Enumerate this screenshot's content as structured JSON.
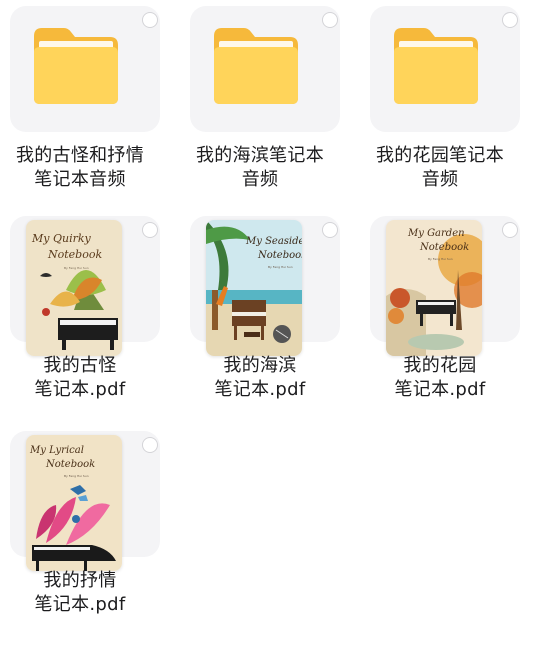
{
  "items": [
    {
      "type": "folder",
      "name": "我的古怪和抒情笔记本音频",
      "line1": "我的古怪和抒情",
      "line2": "笔记本音频"
    },
    {
      "type": "folder",
      "name": "我的海滨笔记本音频",
      "line1": "我的海滨笔记本",
      "line2": "音频"
    },
    {
      "type": "folder",
      "name": "我的花园笔记本音频",
      "line1": "我的花园笔记本",
      "line2": "音频"
    },
    {
      "type": "pdf",
      "name": "我的古怪笔记本.pdf",
      "line1": "我的古怪",
      "line2": "笔记本.pdf",
      "cover_title_1": "My Quirky",
      "cover_title_2": "Notebook",
      "cover_author": "By Feng Hui Sun"
    },
    {
      "type": "pdf",
      "name": "我的海滨笔记本.pdf",
      "line1": "我的海滨",
      "line2": "笔记本.pdf",
      "cover_title_1": "My Seaside",
      "cover_title_2": "Notebook",
      "cover_author": "By Feng Hui Sun"
    },
    {
      "type": "pdf",
      "name": "我的花园笔记本.pdf",
      "line1": "我的花园",
      "line2": "笔记本.pdf",
      "cover_title_1": "My Garden",
      "cover_title_2": "Notebook",
      "cover_author": "By Feng Hui Sun"
    },
    {
      "type": "pdf",
      "name": "我的抒情笔记本.pdf",
      "line1": "我的抒情",
      "line2": "笔记本.pdf",
      "cover_title_1": "My Lyrical",
      "cover_title_2": "Notebook",
      "cover_author": "By Feng Hui Sun"
    }
  ],
  "colors": {
    "folder_back": "#F6B93B",
    "folder_front": "#FFD45A",
    "text": "#1C1C1E",
    "tile_bg": "#F4F4F6"
  }
}
